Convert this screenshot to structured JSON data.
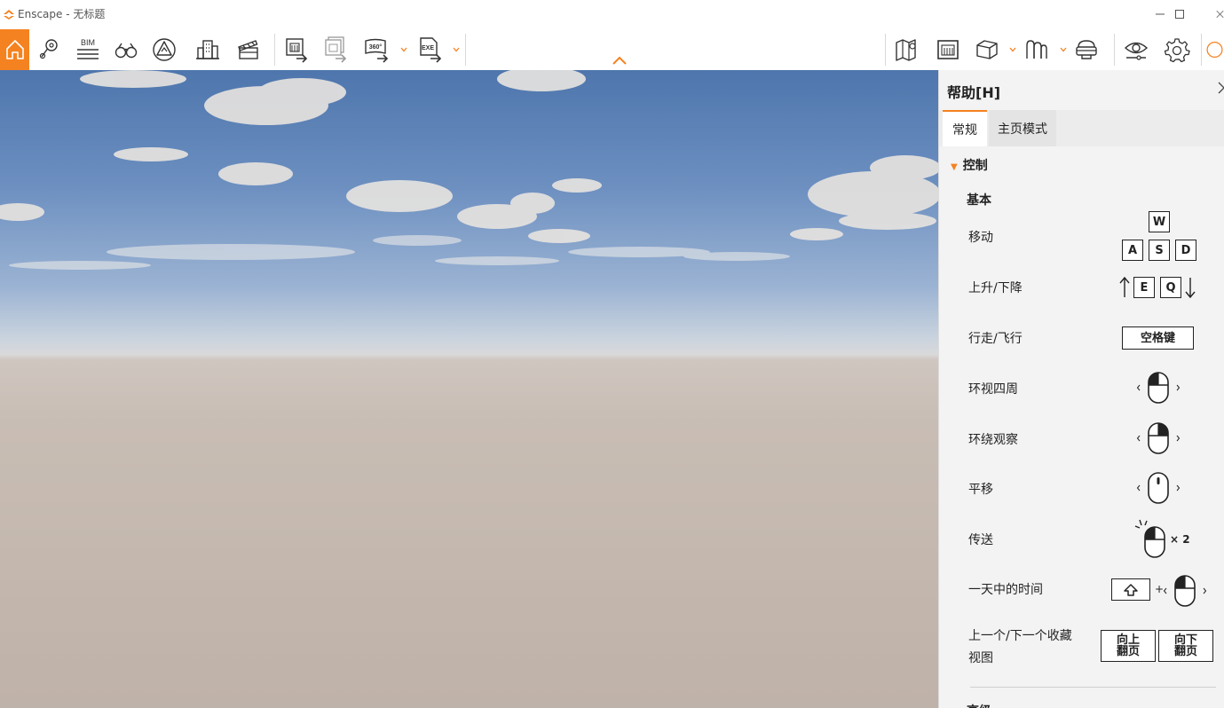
{
  "window": {
    "title": "Enscape - 无标题",
    "icons": [
      "enscape-logo-icon",
      "minimize-icon",
      "maximize-icon",
      "close-icon"
    ]
  },
  "toolbar": {
    "left_tools": [
      "home-icon",
      "location-pin-icon",
      "bim-icon",
      "binoculars-icon",
      "warning-icon",
      "building-icon",
      "clapperboard-icon",
      "export-image-icon",
      "batch-export-icon",
      "export-360-icon",
      "export-exe-icon"
    ],
    "bim_label": "BIM",
    "pano_label": "360°",
    "exe_label": "EXE",
    "right_tools": [
      "map-icon",
      "views-icon",
      "cube-icon",
      "assets-icon",
      "vr-headset-icon",
      "visual-settings-icon",
      "settings-icon"
    ],
    "accent": "#f58220"
  },
  "help": {
    "title": "帮助[H]",
    "tabs": [
      "常规",
      "主页模式"
    ],
    "section": "控制",
    "subsection": "基本",
    "controls": [
      {
        "label": "移动",
        "keys": [
          "W",
          "A",
          "S",
          "D"
        ]
      },
      {
        "label": "上升/下降",
        "keys": [
          "E",
          "Q"
        ]
      },
      {
        "label": "行走/飞行",
        "keys": [
          "空格键"
        ]
      },
      {
        "label": "环视四周",
        "icon": "mouse-left-drag-icon"
      },
      {
        "label": "环绕观察",
        "icon": "mouse-right-drag-icon"
      },
      {
        "label": "平移",
        "icon": "mouse-middle-drag-icon"
      },
      {
        "label": "传送",
        "icon": "mouse-double-click-icon",
        "suffix": "× 2"
      },
      {
        "label": "一天中的时间",
        "icon": "shift-key-icon",
        "plus": "+"
      },
      {
        "label_line1": "上一个/下一个收藏",
        "label_line2": "视图",
        "keys": [
          "向上翻页",
          "向下翻页"
        ],
        "key_lines": [
          [
            "向上",
            "翻页"
          ],
          [
            "向下",
            "翻页"
          ]
        ]
      }
    ],
    "next_section": "高级"
  }
}
